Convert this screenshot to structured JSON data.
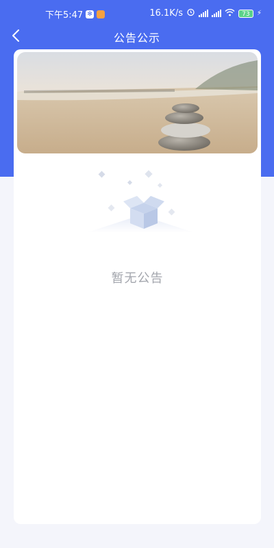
{
  "status_bar": {
    "time": "下午5:47",
    "net_speed": "16.1K/s",
    "battery": "73"
  },
  "header": {
    "title": "公告公示"
  },
  "content": {
    "empty_message": "暂无公告"
  },
  "colors": {
    "brand": "#4a6cf0",
    "page_bg": "#f4f5fb",
    "card_bg": "#ffffff",
    "empty_text": "#a3a6ad"
  }
}
